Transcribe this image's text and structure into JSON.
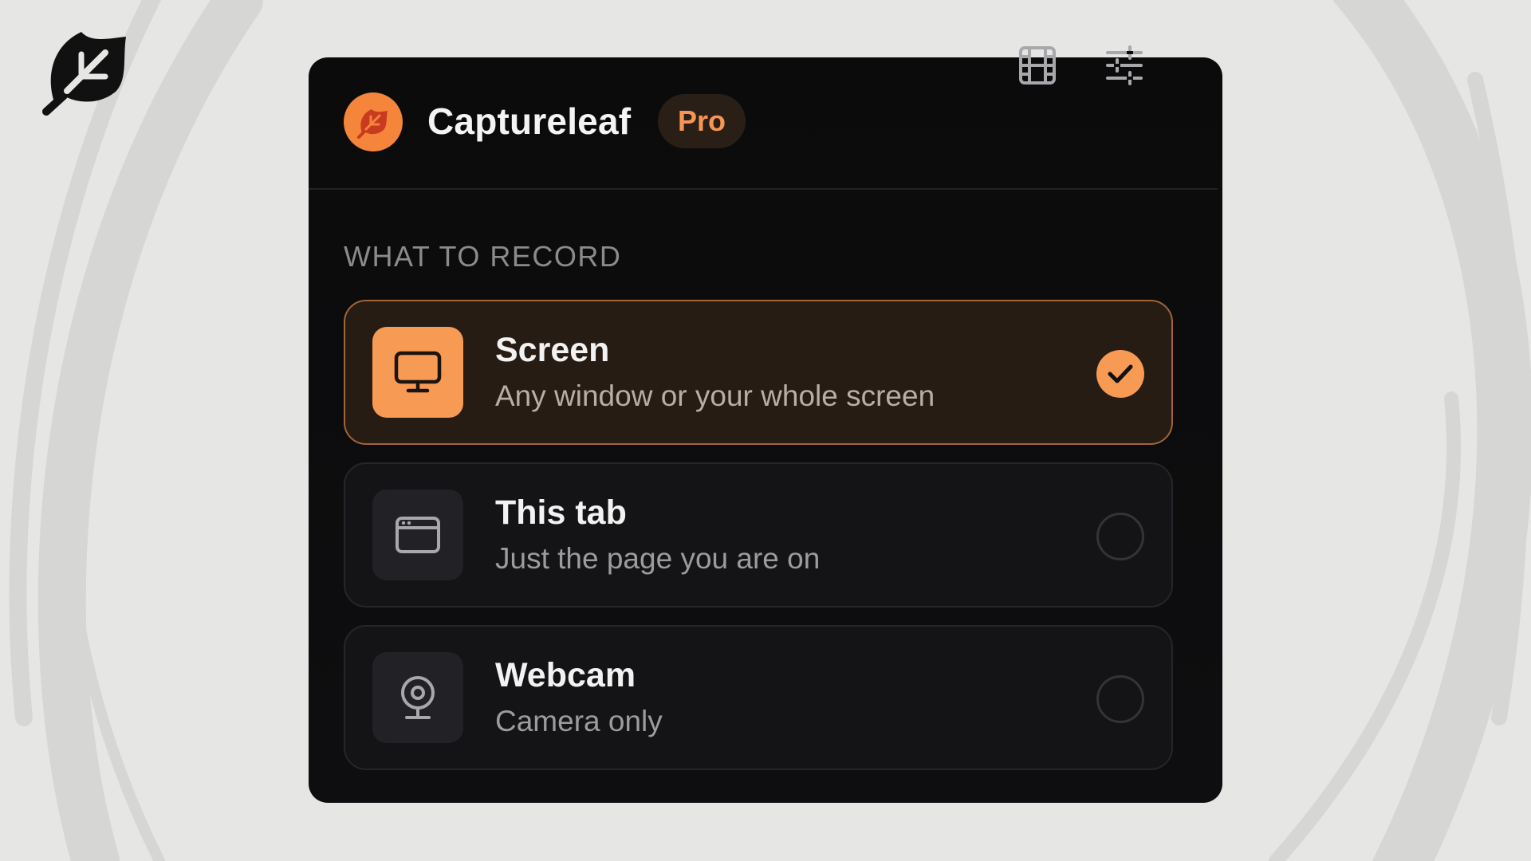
{
  "brand": {
    "name": "Captureleaf",
    "plan_badge": "Pro",
    "accent_color": "#f4853a",
    "icon": "leaf-icon"
  },
  "header": {
    "recordings_icon": "film-icon",
    "settings_icon": "sliders-icon"
  },
  "section": {
    "label": "WHAT TO RECORD"
  },
  "options": [
    {
      "title": "Screen",
      "description": "Any window or your whole screen",
      "icon": "monitor-icon",
      "selected": true
    },
    {
      "title": "This tab",
      "description": "Just the page you are on",
      "icon": "browser-tab-icon",
      "selected": false
    },
    {
      "title": "Webcam",
      "description": "Camera only",
      "icon": "webcam-icon",
      "selected": false
    }
  ]
}
